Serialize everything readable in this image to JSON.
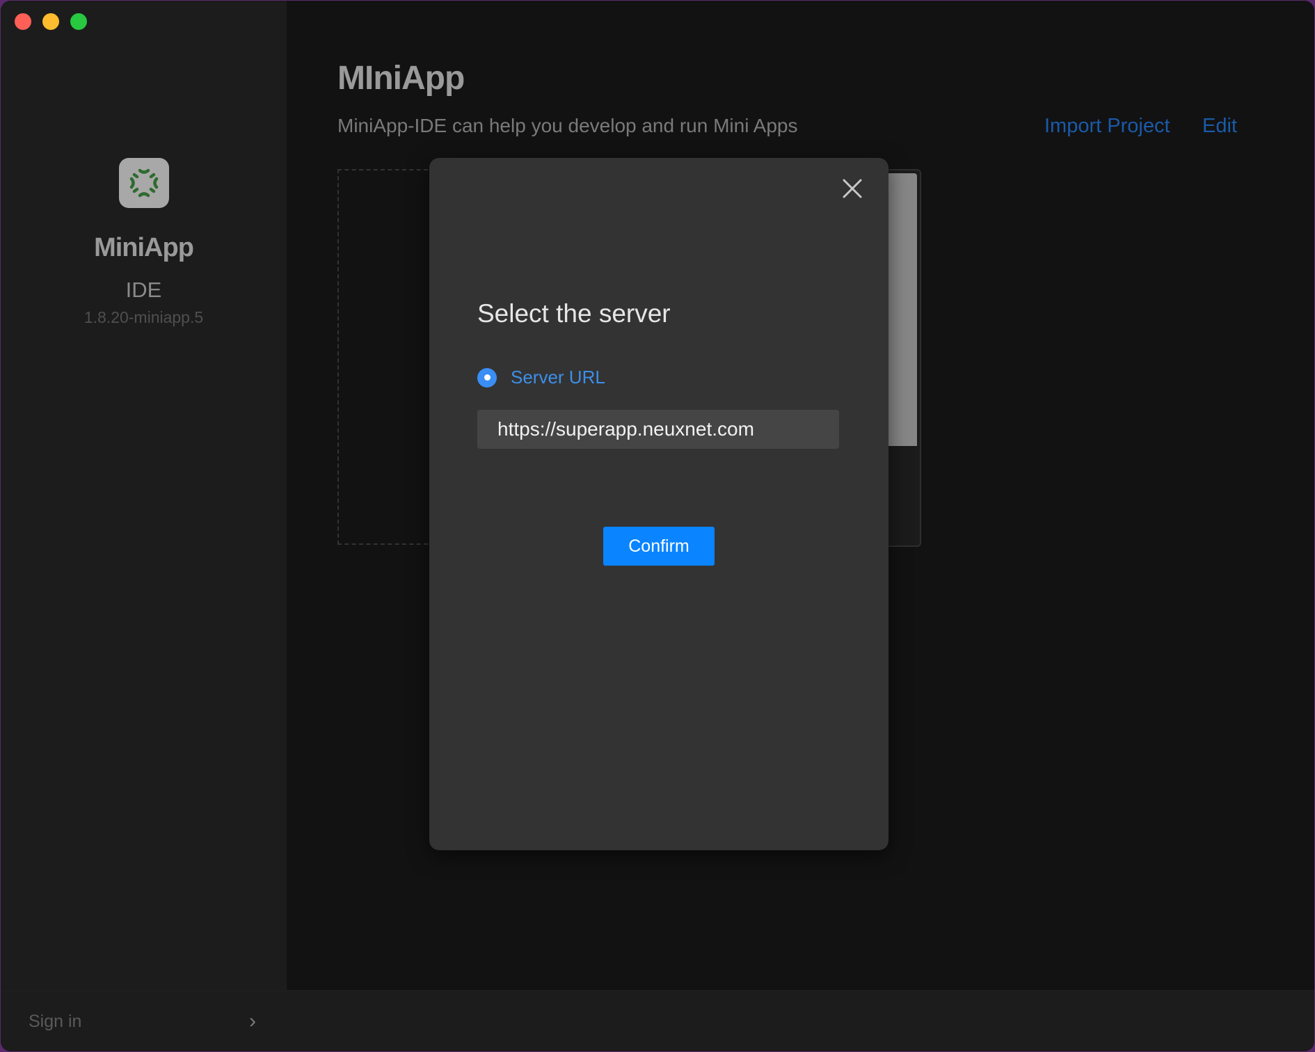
{
  "window": {
    "traffic_lights": [
      "close",
      "minimize",
      "maximize"
    ]
  },
  "sidebar": {
    "logo_icon": "miniapp-logo-icon",
    "app_name": "MiniApp",
    "app_subtitle": "IDE",
    "version": "1.8.20-miniapp.5",
    "signin_label": "Sign in",
    "signin_chevron": "›"
  },
  "main": {
    "title": "MIniApp",
    "description": "MiniApp-IDE can help you develop and run Mini Apps",
    "import_label": "Import Project",
    "edit_label": "Edit"
  },
  "modal": {
    "title": "Select the server",
    "option_label": "Server URL",
    "option_selected": true,
    "url_value": "https://superapp.neuxnet.com",
    "confirm_label": "Confirm"
  },
  "colors": {
    "accent": "#0a84ff",
    "link": "#1a5aa8",
    "radio": "#3a8ef5",
    "logo_green": "#2f6b2f"
  }
}
